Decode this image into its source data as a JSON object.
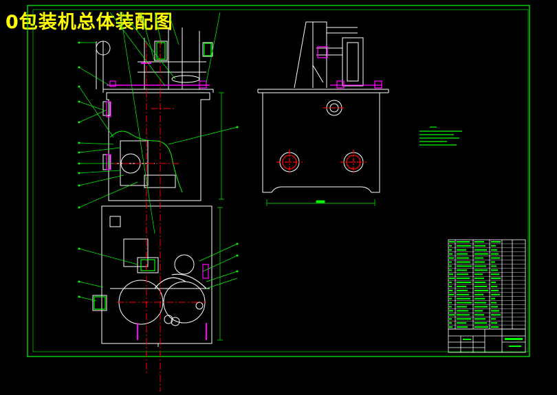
{
  "drawing": {
    "title": "0包装机总体装配图"
  },
  "colors": {
    "frame": "#00ff00",
    "outline": "#ffffff",
    "centerline": "#ff0000",
    "leader": "#00ff00",
    "dimension": "#00ff00",
    "accent": "#ff00ff",
    "title_text": "#ffff00"
  }
}
